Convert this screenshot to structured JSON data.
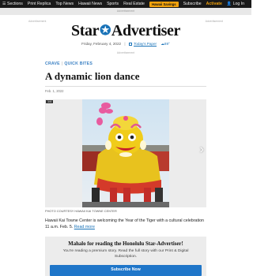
{
  "topnav": {
    "items": [
      {
        "label": "Sections",
        "icon": "menu-icon"
      },
      {
        "label": "Print Replica"
      },
      {
        "label": "Top News"
      },
      {
        "label": "Hawaii News"
      },
      {
        "label": "Sports"
      },
      {
        "label": "Real Estate"
      }
    ],
    "subscribe_badge": "Hawaii Savings",
    "subscribe": "Subscribe",
    "activate": "Activate",
    "login": "Log In"
  },
  "ads": {
    "top": "Advertisement",
    "left": "Advertisement",
    "right": "Advertisement",
    "mid": "Advertisement"
  },
  "masthead": {
    "logo_left": "Star",
    "logo_right": "Advertiser",
    "date": "Friday, February 4, 2022",
    "todays_paper": "Today's Paper",
    "weather": "69°"
  },
  "article": {
    "breadcrumb": [
      "CRAVE",
      "QUICK BITES"
    ],
    "headline": "A dynamic lion dance",
    "pubdate": "Feb. 1, 2022",
    "gallery_counter": "1/4",
    "caption": "PHOTO COURTESY HAWAII KAI TOWNE CENTER",
    "body": "Hawaii Kai Towne Center is welcoming the Year of the Tiger with a cultural celebration 11 a.m. Feb. 5.",
    "read_more": "Read more"
  },
  "paywall": {
    "title": "Mahalo for reading the Honolulu Star-Advertiser!",
    "description": "You're reading a premium story. Read the full story with our Print & Digital Subscription.",
    "button": "Subscribe Now"
  },
  "colors": {
    "accent": "#1a73b8",
    "button": "#1f76c9",
    "nav_bg": "#1a1a1a",
    "badge": "#f2a20c"
  }
}
